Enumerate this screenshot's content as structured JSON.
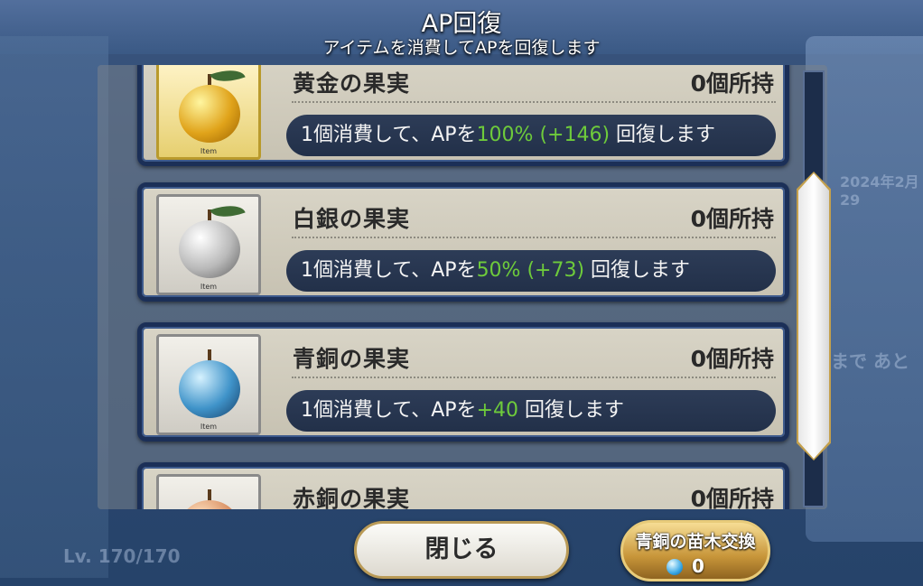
{
  "header": {
    "title": "AP回復",
    "subtitle": "アイテムを消費してAPを回復します"
  },
  "items": [
    {
      "name": "黄金の果実",
      "owned": "0個所持",
      "tag": "Item",
      "effect_prefix": "1個消費して、APを",
      "effect_value": "100% (+146)",
      "effect_suffix": " 回復します"
    },
    {
      "name": "白銀の果実",
      "owned": "0個所持",
      "tag": "Item",
      "effect_prefix": "1個消費して、APを",
      "effect_value": "50% (+73)",
      "effect_suffix": " 回復します"
    },
    {
      "name": "青銅の果実",
      "owned": "0個所持",
      "tag": "Item",
      "effect_prefix": "1個消費して、APを",
      "effect_value": "+40",
      "effect_suffix": " 回復します"
    },
    {
      "name": "赤銅の果実",
      "owned": "0個所持"
    }
  ],
  "buttons": {
    "close_label": "閉じる",
    "exchange_label": "青銅の苗木交換",
    "exchange_count": "0"
  },
  "background": {
    "level_text": "Lv. 170/170",
    "ghost_text_1": "まで あと",
    "ghost_text_2": "2024年2月29"
  },
  "colors": {
    "highlight_green": "#6ecb3b",
    "card_border": "#1b2f57",
    "button_gold": "#c8963a"
  }
}
